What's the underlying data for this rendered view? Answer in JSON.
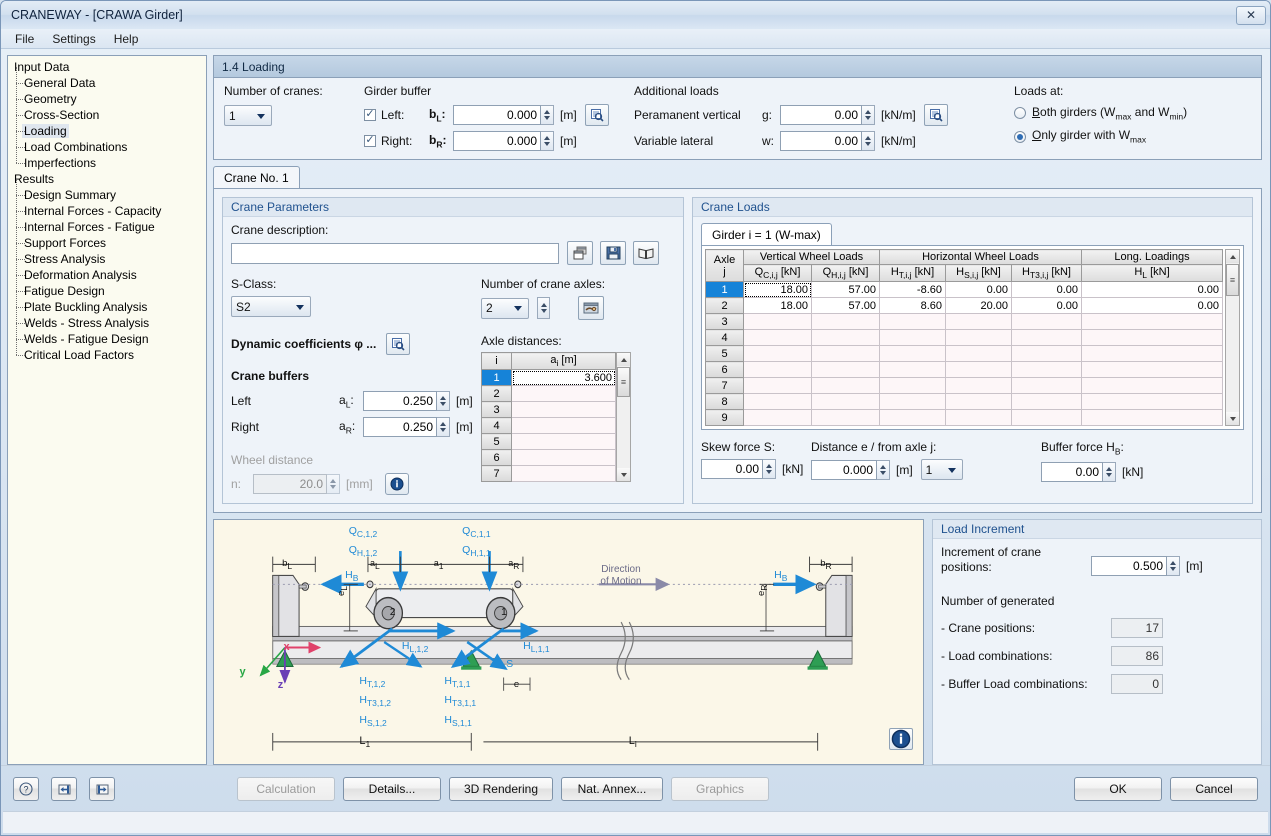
{
  "window": {
    "title": "CRANEWAY - [CRAWA Girder]",
    "close_label": "✕"
  },
  "menu": {
    "items": [
      "File",
      "Settings",
      "Help"
    ]
  },
  "sidebar": {
    "groups": [
      {
        "label": "Input Data",
        "items": [
          "General Data",
          "Geometry",
          "Cross-Section",
          "Loading",
          "Load Combinations",
          "Imperfections"
        ],
        "selected": "Loading"
      },
      {
        "label": "Results",
        "items": [
          "Design Summary",
          "Internal Forces - Capacity",
          "Internal Forces - Fatigue",
          "Support Forces",
          "Stress Analysis",
          "Deformation Analysis",
          "Fatigue Design",
          "Plate Buckling Analysis",
          "Welds - Stress Analysis",
          "Welds - Fatigue Design",
          "Critical Load Factors"
        ],
        "selected": ""
      }
    ]
  },
  "page": {
    "header": "1.4 Loading"
  },
  "top": {
    "cranes_label": "Number of cranes:",
    "cranes_value": "1",
    "girder_buffer_label": "Girder buffer",
    "left_label": "Left:",
    "left_checked": true,
    "right_label": "Right:",
    "right_checked": true,
    "bl_symbol": "b",
    "bl_sub": "L",
    "bl_value": "0.000",
    "br_symbol": "b",
    "br_sub": "R",
    "br_value": "0.000",
    "unit_m": "[m]",
    "additional_loads_label": "Additional loads",
    "permanent_vertical_label": "Peramanent vertical",
    "g_symbol": "g:",
    "g_value": "0.00",
    "variable_lateral_label": "Variable lateral",
    "w_symbol": "w:",
    "w_value": "0.00",
    "unit_knm": "[kN/m]",
    "loads_at_label": "Loads at:",
    "radio_both": "Both girders (W",
    "radio_both_sub1": "max",
    "radio_both_mid": " and W",
    "radio_both_sub2": "min",
    "radio_both_end": ")",
    "radio_only": "Only girder with W",
    "radio_only_sub": "max",
    "selected_radio": "only"
  },
  "tabs": {
    "crane_tab": "Crane No. 1"
  },
  "crane_parameters": {
    "group_title": "Crane Parameters",
    "description_label": "Crane description:",
    "description_value": "",
    "sclass_label": "S-Class:",
    "sclass_value": "S2",
    "dynamic_label": "Dynamic coefficients φ ...",
    "buffers_label": "Crane buffers",
    "left_label": "Left",
    "al_symbol": "a",
    "al_sub": "L",
    "al_value": "0.250",
    "right_label": "Right",
    "ar_symbol": "a",
    "ar_sub": "R",
    "ar_value": "0.250",
    "wheel_distance_label": "Wheel distance",
    "n_label": "n:",
    "n_value": "20.0",
    "unit_mm": "[mm]",
    "unit_m": "[m]",
    "axles_label": "Number of crane axles:",
    "axles_value": "2",
    "axle_distances_label": "Axle distances:",
    "axle_table": {
      "headers": [
        "i",
        "a i [m]"
      ],
      "header_i": "i",
      "header_a": "a",
      "header_a_sub": "i",
      "header_a_unit": " [m]",
      "rows": [
        {
          "i": "1",
          "a": "3.600",
          "selected": true
        },
        {
          "i": "2",
          "a": ""
        },
        {
          "i": "3",
          "a": ""
        },
        {
          "i": "4",
          "a": ""
        },
        {
          "i": "5",
          "a": ""
        },
        {
          "i": "6",
          "a": ""
        },
        {
          "i": "7",
          "a": ""
        }
      ]
    }
  },
  "crane_loads": {
    "group_title": "Crane Loads",
    "girder_tab": "Girder i = 1 (W-max)",
    "col_axle": "Axle",
    "col_axle_sub": "j",
    "grp_vertical": "Vertical Wheel Loads",
    "grp_horizontal": "Horizontal Wheel Loads",
    "grp_long": "Long. Loadings",
    "sub_headers": [
      {
        "sym": "Q",
        "sub": "C,i,j",
        "unit": " [kN]"
      },
      {
        "sym": "Q",
        "sub": "H,i,j",
        "unit": " [kN]"
      },
      {
        "sym": "H",
        "sub": "T,i,j",
        "unit": " [kN]"
      },
      {
        "sym": "H",
        "sub": "S,i,j",
        "unit": " [kN]"
      },
      {
        "sym": "H",
        "sub": "T3,i,j",
        "unit": " [kN]"
      },
      {
        "sym": "H",
        "sub": "L",
        "unit": " [kN]"
      }
    ],
    "rows": [
      {
        "j": "1",
        "qc": "18.00",
        "qh": "57.00",
        "ht": "-8.60",
        "hs": "0.00",
        "ht3": "0.00",
        "hl": "0.00",
        "selected": true
      },
      {
        "j": "2",
        "qc": "18.00",
        "qh": "57.00",
        "ht": "8.60",
        "hs": "20.00",
        "ht3": "0.00",
        "hl": "0.00"
      },
      {
        "j": "3",
        "qc": "",
        "qh": "",
        "ht": "",
        "hs": "",
        "ht3": "",
        "hl": ""
      },
      {
        "j": "4",
        "qc": "",
        "qh": "",
        "ht": "",
        "hs": "",
        "ht3": "",
        "hl": ""
      },
      {
        "j": "5",
        "qc": "",
        "qh": "",
        "ht": "",
        "hs": "",
        "ht3": "",
        "hl": ""
      },
      {
        "j": "6",
        "qc": "",
        "qh": "",
        "ht": "",
        "hs": "",
        "ht3": "",
        "hl": ""
      },
      {
        "j": "7",
        "qc": "",
        "qh": "",
        "ht": "",
        "hs": "",
        "ht3": "",
        "hl": ""
      },
      {
        "j": "8",
        "qc": "",
        "qh": "",
        "ht": "",
        "hs": "",
        "ht3": "",
        "hl": ""
      },
      {
        "j": "9",
        "qc": "",
        "qh": "",
        "ht": "",
        "hs": "",
        "ht3": "",
        "hl": ""
      }
    ],
    "skew_label": "Skew force S:",
    "skew_value": "0.00",
    "unit_kn": "[kN]",
    "distance_label": "Distance e / from axle j:",
    "distance_value": "0.000",
    "unit_m": "[m]",
    "distance_axle": "1",
    "buffer_label_pre": "Buffer force H",
    "buffer_label_sub": "B",
    "buffer_label_post": ":",
    "buffer_value": "0.00"
  },
  "load_increment": {
    "group_title": "Load Increment",
    "increment_label_l1": "Increment of crane",
    "increment_label_l2": "positions:",
    "increment_value": "0.500",
    "unit_m": "[m]",
    "generated_label": "Number of generated",
    "crane_positions_label": "- Crane positions:",
    "crane_positions_value": "17",
    "load_comb_label": "- Load combinations:",
    "load_comb_value": "86",
    "buffer_comb_label": "- Buffer Load combinations:",
    "buffer_comb_value": "0"
  },
  "diagram": {
    "labels": {
      "qc2": "Q",
      "qc2_sub": "C,1,2",
      "qc1": "Q",
      "qc1_sub": "C,1,1",
      "qh2": "Q",
      "qh2_sub": "H,1,2",
      "qh1": "Q",
      "qh1_sub": "H,1,1",
      "bl": "b",
      "bl_sub": "L",
      "br": "b",
      "br_sub": "R",
      "aL": "a",
      "aL_sub": "L",
      "a1": "a",
      "a1_sub": "1",
      "aR": "a",
      "aR_sub": "R",
      "hb": "H",
      "hb_sub": "B",
      "eL": "e",
      "eL_sub": "L",
      "eR": "e",
      "eR_sub": "R",
      "hl2": "H",
      "hl2_sub": "L,1,2",
      "hl1": "H",
      "hl1_sub": "L,1,1",
      "ht2": "H",
      "ht2_sub": "T,1,2",
      "ht1": "H",
      "ht1_sub": "T,1,1",
      "ht32": "H",
      "ht32_sub": "T3,1,2",
      "ht31": "H",
      "ht31_sub": "T3,1,1",
      "hs2": "H",
      "hs2_sub": "S,1,2",
      "hs1": "H",
      "hs1_sub": "S,1,1",
      "s": "S",
      "e": "e",
      "L1": "L",
      "L1_sub": "1",
      "Li": "L",
      "Li_sub": "i",
      "axis_x": "x",
      "axis_y": "y",
      "axis_z": "z",
      "wheel2": "2",
      "wheel1": "1",
      "direction_l1": "Direction",
      "direction_l2": "of Motion"
    },
    "colors": {
      "load": "#1f8ad6",
      "axis_x": "#e0426a",
      "axis_y": "#28a745",
      "axis_z": "#6a3fb5",
      "support": "#2e9e54"
    }
  },
  "bottom": {
    "help_icon": "?",
    "prev_icon": "◄|",
    "next_icon": "|►",
    "calculation": "Calculation",
    "details": "Details...",
    "rendering": "3D Rendering",
    "nat_annex": "Nat. Annex...",
    "graphics": "Graphics",
    "ok": "OK",
    "cancel": "Cancel"
  }
}
